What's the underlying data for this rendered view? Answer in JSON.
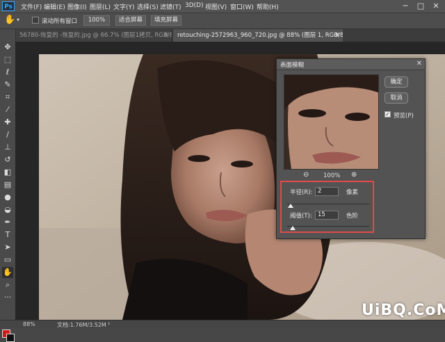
{
  "menu": [
    "文件(F)",
    "编辑(E)",
    "图像(I)",
    "图层(L)",
    "文字(Y)",
    "选择(S)",
    "滤镜(T)",
    "3D(D)",
    "视图(V)",
    "窗口(W)",
    "帮助(H)"
  ],
  "window_controls": [
    "─",
    "□",
    "✕"
  ],
  "options": {
    "scroll_all_label": "滚动所有窗口",
    "zoom_value": "100%",
    "fit_screen_label": "适合屏幕",
    "fill_screen_label": "填充屏幕"
  },
  "tabs": [
    {
      "title": "56780-恢复的 -恢复的.jpg @ 66.7% (图层1拷贝, RGB/8#) *",
      "close": "✕"
    },
    {
      "title": "retouching-2572963_960_720.jpg @ 88% (图层 1, RGB/8#) *",
      "close": "✕"
    }
  ],
  "dialog": {
    "title": "表面模糊",
    "close": "✕",
    "ok_label": "确定",
    "cancel_label": "取消",
    "preview_label": "预览(P)",
    "preview_checked": true,
    "preview_zoom": "100%",
    "radius_label": "半径(R):",
    "radius_value": "2",
    "radius_unit": "像素",
    "threshold_label": "阈值(T):",
    "threshold_value": "15",
    "threshold_unit": "色阶",
    "highlight_color": "#e04b4b"
  },
  "status": {
    "zoom": "88%",
    "doc_size": "文档:1.76M/3.52M"
  },
  "watermark": "UiBQ.CoM",
  "colors": {
    "foreground": "#d41b1b",
    "background": "#111111"
  }
}
